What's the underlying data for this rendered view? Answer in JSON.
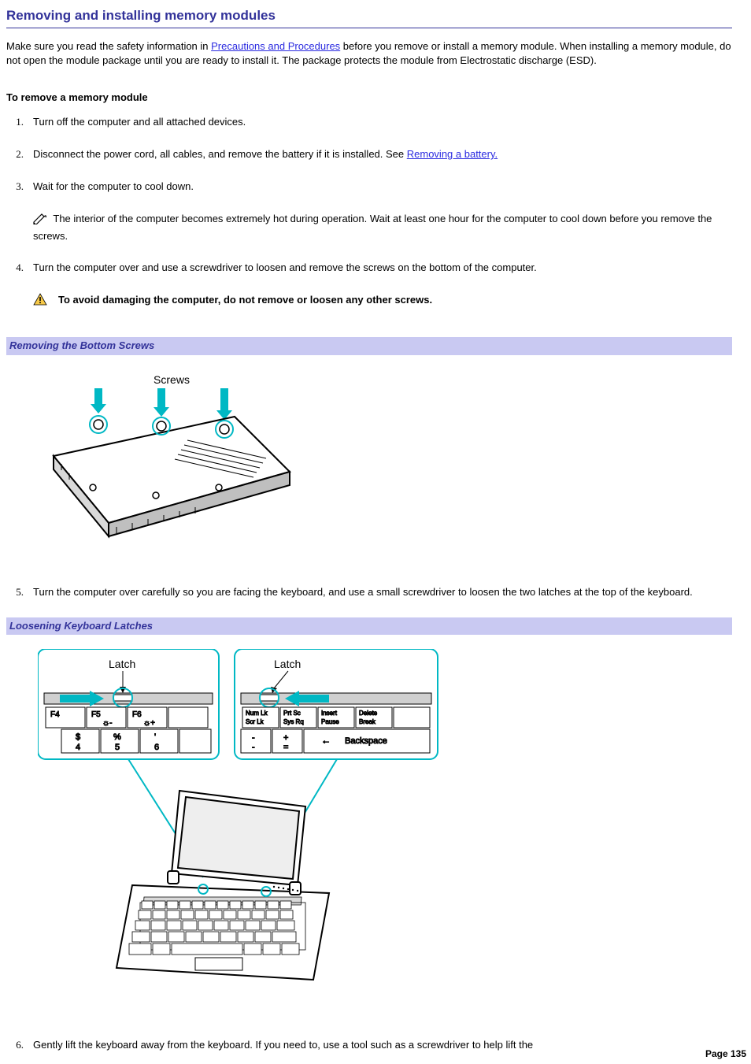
{
  "title": "Removing and installing memory modules",
  "intro_pre": "Make sure you read the safety information in ",
  "intro_link": "Precautions and Procedures",
  "intro_post": " before you remove or install a memory module. When installing a memory module, do not open the module package until you are ready to install it. The package protects the module from Electrostatic discharge (ESD).",
  "subhead": "To remove a memory module",
  "steps": {
    "s1": "Turn off the computer and all attached devices.",
    "s2_pre": "Disconnect the power cord, all cables, and remove the battery if it is installed. See ",
    "s2_link": "Removing a battery.",
    "s3": "Wait for the computer to cool down.",
    "s3_note": " The interior of the computer becomes extremely hot during operation. Wait at least one hour for the computer to cool down before you remove the screws.",
    "s4": "Turn the computer over and use a screwdriver to loosen and remove the screws on the bottom of the computer.",
    "s4_warn": "To avoid damaging the computer, do not remove or loosen any other screws.",
    "s5": "Turn the computer over carefully so you are facing the keyboard, and use a small screwdriver to loosen the two latches at the top of the keyboard.",
    "s6": "Gently lift the keyboard away from the keyboard. If you need to, use a tool such as a screwdriver to help lift the"
  },
  "nums": {
    "n1": "1.",
    "n2": "2.",
    "n3": "3.",
    "n4": "4.",
    "n5": "5.",
    "n6": "6."
  },
  "caption1": "Removing the Bottom Screws",
  "caption2": "Loosening Keyboard Latches",
  "fig1": {
    "label_screws": "Screws"
  },
  "fig2": {
    "label_latch": "Latch",
    "k_f4": "F4",
    "k_f5": "F5",
    "k_f6": "F6",
    "k_dollar": "$",
    "k_4": "4",
    "k_pct": "%",
    "k_5": "5",
    "k_ap": "'",
    "k_6": "6",
    "k_numlk1": "Num Lk",
    "k_numlk2": "Scr Lk",
    "k_prt1": "Prt Sc",
    "k_prt2": "Sys Rq",
    "k_ins1": "Insert",
    "k_ins2": "Pause",
    "k_del1": "Delete",
    "k_del2": "Break",
    "k_minus": "-",
    "k_under": "-",
    "k_plus": "+",
    "k_eq": "=",
    "k_back": "Backspace",
    "k_back_arrow": "←"
  },
  "page_number": "Page 135"
}
